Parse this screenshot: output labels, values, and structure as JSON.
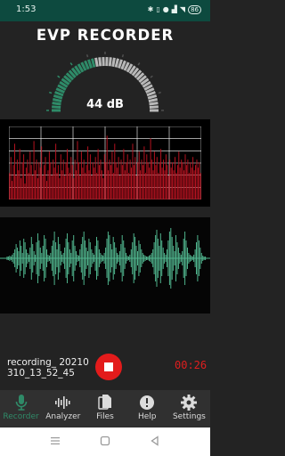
{
  "status_bar": {
    "time": "1:53",
    "icons": [
      "bluetooth-icon",
      "vibrate-icon",
      "location-icon",
      "signal-icon",
      "wifi-icon"
    ],
    "battery": "86"
  },
  "app": {
    "title": "EVP RECORDER"
  },
  "meter": {
    "value_label": "44 dB",
    "level_fraction": 0.44,
    "color_lit": "#2e8b68",
    "color_unlit": "#b8b8b8"
  },
  "spectrum": {
    "grid_color": "#ffffff",
    "bar_color": "#b3121f",
    "peaks": [
      20,
      32,
      14,
      26,
      42,
      18,
      30,
      22,
      38,
      16,
      28,
      34,
      12,
      24,
      30,
      20,
      36,
      26,
      18,
      44,
      22,
      30,
      16,
      28,
      24,
      40,
      18,
      26,
      32,
      14,
      22,
      36,
      28,
      18,
      30,
      24,
      42,
      20,
      26,
      16,
      34,
      22,
      30,
      18,
      28,
      38,
      24,
      20,
      32,
      26,
      16,
      30,
      22,
      44,
      28,
      18,
      36,
      24,
      30,
      20,
      26,
      40,
      22,
      34,
      18,
      28,
      24,
      32,
      20,
      38,
      26,
      30,
      22,
      16,
      34,
      28,
      48,
      22,
      30,
      26,
      36,
      20,
      42,
      28,
      24,
      32,
      18,
      30,
      26,
      38,
      22,
      28,
      34,
      20,
      30,
      24,
      42,
      26,
      32,
      18,
      28,
      36,
      22,
      30,
      26,
      40,
      20,
      34,
      28,
      24,
      46,
      30,
      22,
      36,
      26,
      32,
      20,
      28,
      38,
      24,
      30,
      22,
      34,
      26,
      18,
      30,
      24,
      28,
      22,
      32,
      20,
      26,
      36,
      24,
      30,
      28,
      22,
      34,
      26,
      30,
      20,
      28,
      24,
      32,
      22,
      26,
      30,
      24,
      28,
      20
    ]
  },
  "waveform": {
    "color": "#4fb38c",
    "amps": [
      2,
      2,
      3,
      2,
      4,
      6,
      10,
      16,
      12,
      8,
      20,
      14,
      6,
      22,
      18,
      10,
      6,
      4,
      12,
      24,
      16,
      8,
      4,
      18,
      28,
      20,
      12,
      6,
      14,
      26,
      22,
      10,
      4,
      3,
      6,
      14,
      20,
      30,
      18,
      10,
      24,
      16,
      8,
      4,
      6,
      12,
      22,
      28,
      18,
      10,
      6,
      20,
      26,
      14,
      8,
      4,
      3,
      10,
      16,
      24,
      30,
      20,
      12,
      8,
      22,
      18,
      10,
      6,
      4,
      14,
      24,
      20,
      10,
      6,
      4,
      3,
      6,
      12,
      22,
      30,
      26,
      16,
      10,
      24,
      18,
      12,
      6,
      4,
      8,
      16,
      26,
      20,
      12,
      6,
      3,
      2,
      4,
      10,
      18,
      28,
      24,
      14,
      8,
      20,
      16,
      10,
      6,
      4,
      3,
      2,
      2,
      3,
      4,
      6,
      10,
      18,
      26,
      32,
      22,
      14,
      28,
      20,
      12,
      6,
      4,
      10,
      20,
      30,
      34,
      24,
      14,
      8,
      26,
      18,
      12,
      6,
      4,
      8,
      22,
      30,
      20,
      12,
      6,
      4,
      3,
      2,
      4,
      10,
      18,
      26,
      20,
      12,
      6,
      3,
      2,
      2
    ]
  },
  "recording": {
    "filename_line1": "recording_ 20210",
    "filename_line2": "310_13_52_45",
    "timer": "00:26"
  },
  "nav": [
    {
      "id": "recorder",
      "label": "Recorder",
      "icon": "microphone-icon",
      "active": true
    },
    {
      "id": "analyzer",
      "label": "Analyzer",
      "icon": "waveform-icon",
      "active": false
    },
    {
      "id": "files",
      "label": "Files",
      "icon": "files-icon",
      "active": false
    },
    {
      "id": "help",
      "label": "Help",
      "icon": "help-icon",
      "active": false
    },
    {
      "id": "settings",
      "label": "Settings",
      "icon": "gear-icon",
      "active": false
    }
  ]
}
